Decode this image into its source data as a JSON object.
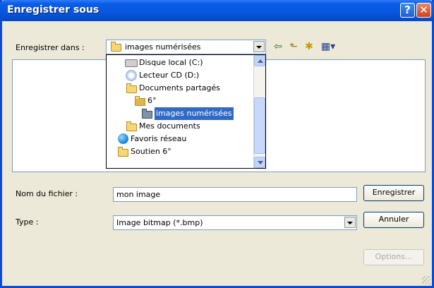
{
  "window": {
    "title": "Enregistrer sous",
    "help_symbol": "?",
    "close_symbol": "✕"
  },
  "save_in": {
    "label": "Enregistrer dans :",
    "current": "images numérisées",
    "dropdown_items": [
      {
        "label": "Disque local (C:)",
        "icon": "hard-drive-icon"
      },
      {
        "label": "Lecteur CD (D:)",
        "icon": "cd-drive-icon"
      },
      {
        "label": "Documents partagés",
        "icon": "folder-icon"
      },
      {
        "label": "6°",
        "icon": "folder-icon"
      },
      {
        "label": "images numérisées",
        "icon": "folder-icon",
        "selected": true
      },
      {
        "label": "Mes documents",
        "icon": "folder-icon"
      },
      {
        "label": "Favoris réseau",
        "icon": "network-globe-icon"
      },
      {
        "label": "Soutien 6°",
        "icon": "folder-icon"
      }
    ]
  },
  "toolbar": {
    "back_symbol": "⇦",
    "up_symbol": "⬑",
    "new_folder_symbol": "✱",
    "views_symbol": "▦▾"
  },
  "file_name": {
    "label": "Nom du fichier :",
    "value": "mon image"
  },
  "file_type": {
    "label": "Type :",
    "value": "Image bitmap (*.bmp)"
  },
  "buttons": {
    "save": "Enregistrer",
    "cancel": "Annuler",
    "options": "Options..."
  },
  "colors": {
    "title_bar": "#0757e0",
    "selection": "#316ac5",
    "dialog_bg": "#ece9d8"
  }
}
